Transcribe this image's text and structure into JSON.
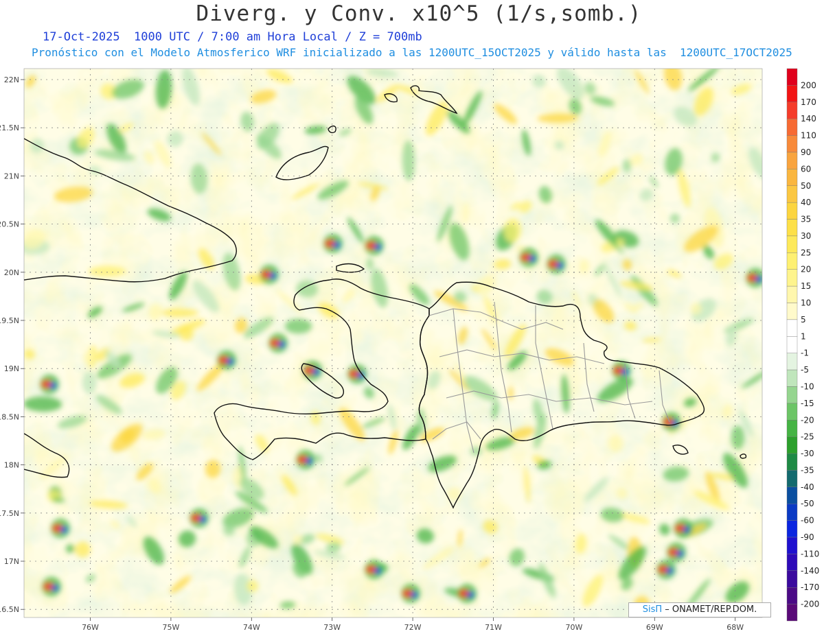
{
  "header": {
    "title": "Diverg. y Conv. x10^5 (1/s,somb.)",
    "line1": "17-Oct-2025  1000 UTC / 7:00 am Hora Local / Z = 700mb",
    "line2": "Pronóstico con el Modelo Atmosferico WRF inicializado a las 1200UTC_15OCT2025 y válido hasta las  1200UTC_17OCT2025"
  },
  "axes": {
    "lat_labels": [
      "22N",
      "21.5N",
      "21N",
      "20.5N",
      "20N",
      "19.5N",
      "19N",
      "18.5N",
      "18N",
      "17.5N",
      "17N",
      "16.5N"
    ],
    "lon_labels": [
      "76W",
      "75W",
      "74W",
      "73W",
      "72W",
      "71W",
      "70W",
      "69W",
      "68W"
    ]
  },
  "colorbar": {
    "labels": [
      "200",
      "170",
      "140",
      "110",
      "90",
      "60",
      "50",
      "40",
      "35",
      "30",
      "25",
      "20",
      "15",
      "10",
      "5",
      "1",
      "-1",
      "-5",
      "-10",
      "-15",
      "-20",
      "-25",
      "-30",
      "-35",
      "-40",
      "-50",
      "-60",
      "-90",
      "-110",
      "-140",
      "-170",
      "-200"
    ],
    "colors": [
      "#e0001c",
      "#f21414",
      "#f53c2a",
      "#f76a33",
      "#f88a3a",
      "#f9a43e",
      "#fab63f",
      "#fbc742",
      "#fcd53f",
      "#fde048",
      "#fde95a",
      "#fef071",
      "#fef48d",
      "#fff7ad",
      "#fffacb",
      "#ffffff",
      "#ffffff",
      "#e4f4e1",
      "#c0e6bc",
      "#95d58f",
      "#6cc566",
      "#45b444",
      "#2ca02c",
      "#1e8a45",
      "#136a6e",
      "#0a4fa0",
      "#0a3ac4",
      "#0a25e0",
      "#1e10cf",
      "#2d0ab8",
      "#3b0a9e",
      "#4b0a86",
      "#5a0a78"
    ]
  },
  "credit": {
    "brand": "SisΠ",
    "text": " – ONAMET/REP.DOM."
  }
}
